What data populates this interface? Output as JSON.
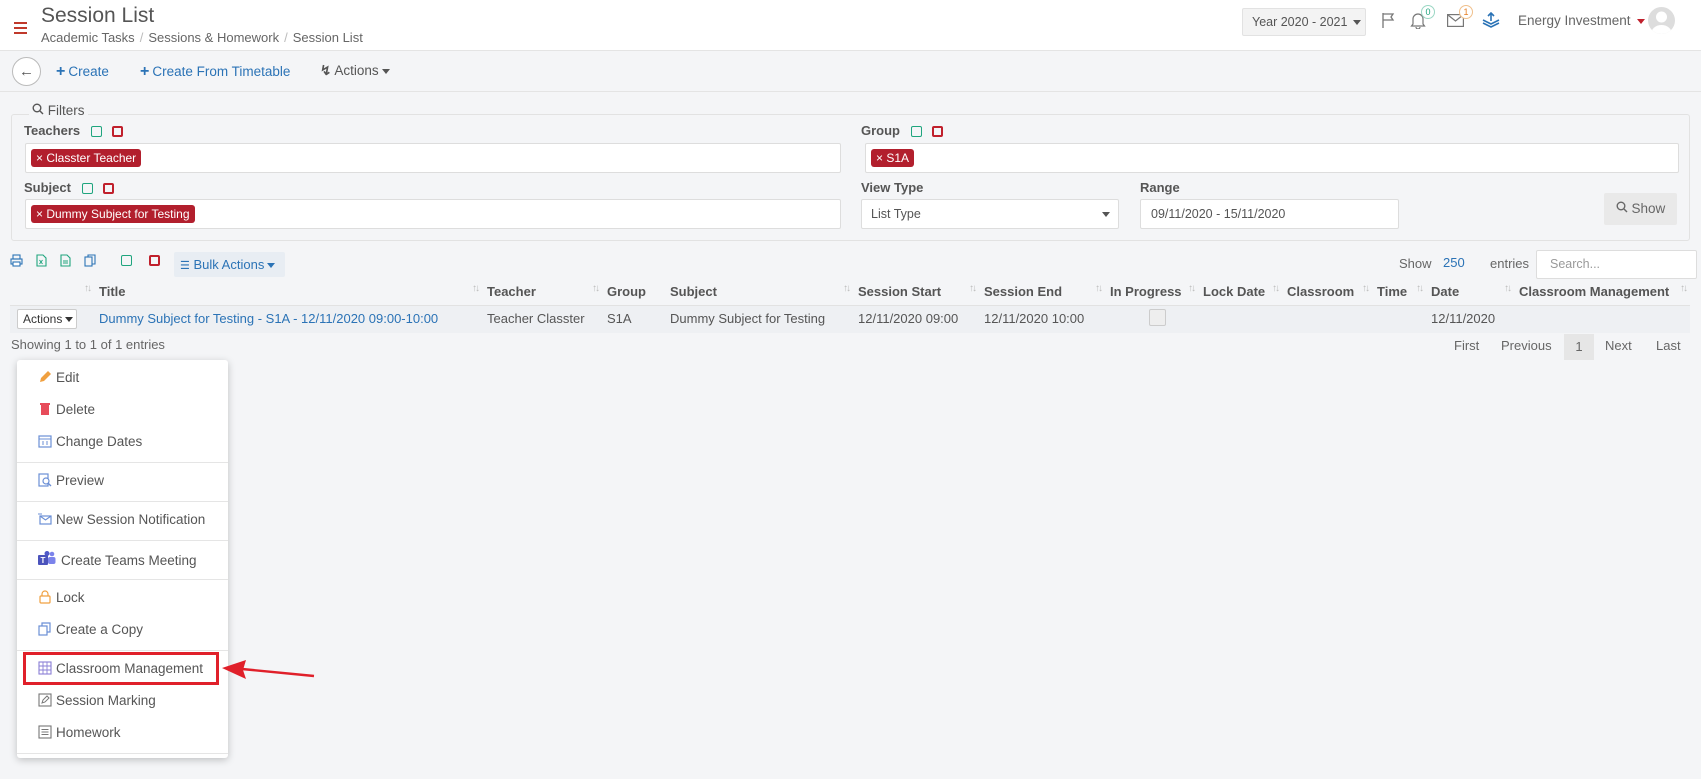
{
  "header": {
    "title": "Session List",
    "breadcrumb": [
      "Academic Tasks",
      "Sessions & Homework",
      "Session List"
    ],
    "year_select": "Year 2020 - 2021",
    "notifications_count": "0",
    "messages_count": "1",
    "user_name": "Energy Investment"
  },
  "toolbar": {
    "create_label": "Create",
    "create_from_timetable_label": "Create From Timetable",
    "actions_label": "Actions"
  },
  "filters": {
    "legend": "Filters",
    "teachers_label": "Teachers",
    "teachers_tag": "Classter Teacher",
    "group_label": "Group",
    "group_tag": "S1A",
    "subject_label": "Subject",
    "subject_tag": "Dummy Subject for Testing",
    "view_type_label": "View Type",
    "view_type_value": "List Type",
    "range_label": "Range",
    "range_value": "09/11/2020 - 15/11/2020",
    "show_button": "Show"
  },
  "table_tools": {
    "bulk_actions": "Bulk Actions",
    "show_label": "Show",
    "show_count": "250",
    "entries_label": "entries",
    "search_placeholder": "Search..."
  },
  "table": {
    "columns": [
      "Title",
      "Teacher",
      "Group",
      "Subject",
      "Session Start",
      "Session End",
      "In Progress",
      "Lock Date",
      "Classroom",
      "Time",
      "Date",
      "Classroom Management"
    ],
    "rows": [
      {
        "actions": "Actions",
        "title": "Dummy Subject for Testing - S1A - 12/11/2020 09:00-10:00",
        "teacher": "Teacher Classter",
        "group": "S1A",
        "subject": "Dummy Subject for Testing",
        "session_start": "12/11/2020 09:00",
        "session_end": "12/11/2020 10:00",
        "date": "12/11/2020"
      }
    ],
    "showing": "Showing 1 to 1 of 1 entries"
  },
  "pagination": {
    "first": "First",
    "previous": "Previous",
    "current": "1",
    "next": "Next",
    "last": "Last"
  },
  "context_menu": {
    "items": [
      "Edit",
      "Delete",
      "Change Dates",
      "Preview",
      "New Session Notification",
      "Create Teams Meeting",
      "Lock",
      "Create a Copy",
      "Classroom Management",
      "Session Marking",
      "Homework"
    ]
  },
  "colors": {
    "accent": "#2b73b6",
    "tag_red": "#b21f2d",
    "highlight_red": "#e0202a"
  }
}
